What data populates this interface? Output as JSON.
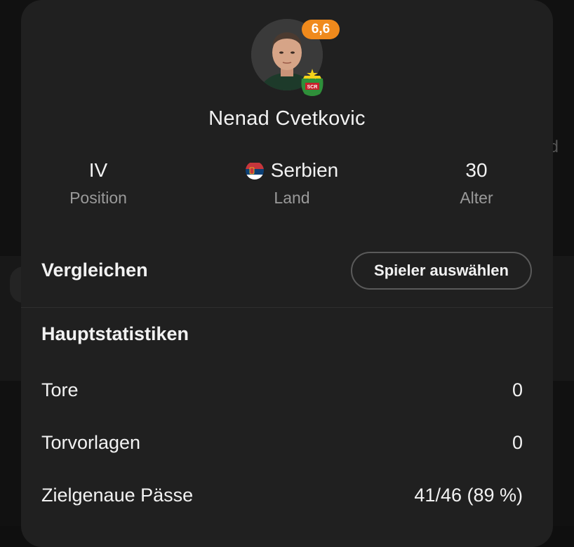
{
  "player": {
    "name": "Nenad Cvetkovic",
    "rating": "6,6",
    "club_badge_text": "SCR",
    "rating_color": "#f08a1c"
  },
  "info": {
    "position": {
      "value": "IV",
      "label": "Position"
    },
    "country": {
      "value": "Serbien",
      "label": "Land",
      "flag_icon": "serbia-flag-icon"
    },
    "age": {
      "value": "30",
      "label": "Alter"
    }
  },
  "compare": {
    "title": "Vergleichen",
    "button_label": "Spieler auswählen"
  },
  "main_stats": {
    "title": "Hauptstatistiken",
    "rows": [
      {
        "label": "Tore",
        "value": "0"
      },
      {
        "label": "Torvorlagen",
        "value": "0"
      },
      {
        "label": "Zielgenaue Pässe",
        "value": "41/46 (89 %)"
      }
    ]
  },
  "background": {
    "partial_text": "d"
  }
}
